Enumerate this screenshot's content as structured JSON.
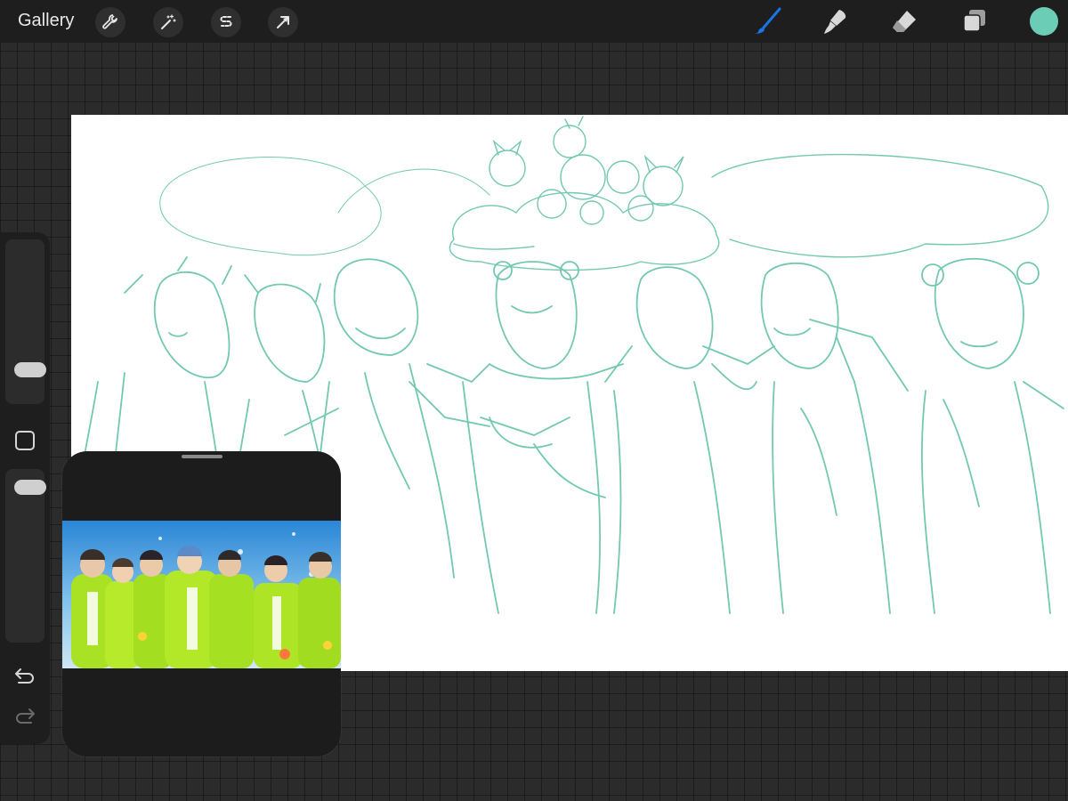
{
  "topbar": {
    "gallery_label": "Gallery",
    "left_tools": [
      "wrench-icon",
      "magic-wand-icon",
      "selection-icon",
      "transform-arrow-icon"
    ],
    "right_tools": [
      "brush-icon",
      "smudge-icon",
      "eraser-icon",
      "layers-icon"
    ],
    "active_tool": "brush-icon",
    "current_color": "#6ccdb6"
  },
  "colors": {
    "accent_blue": "#1a73e8",
    "sketch_line": "#5bbfa2",
    "panel_bg": "#1e1e1e"
  },
  "sidebar": {
    "brush_size_level": 0.25,
    "opacity_level": 0.85,
    "icons": [
      "modifier-square-icon",
      "undo-icon",
      "redo-icon"
    ]
  },
  "reference": {
    "icon": "reference-photo"
  }
}
